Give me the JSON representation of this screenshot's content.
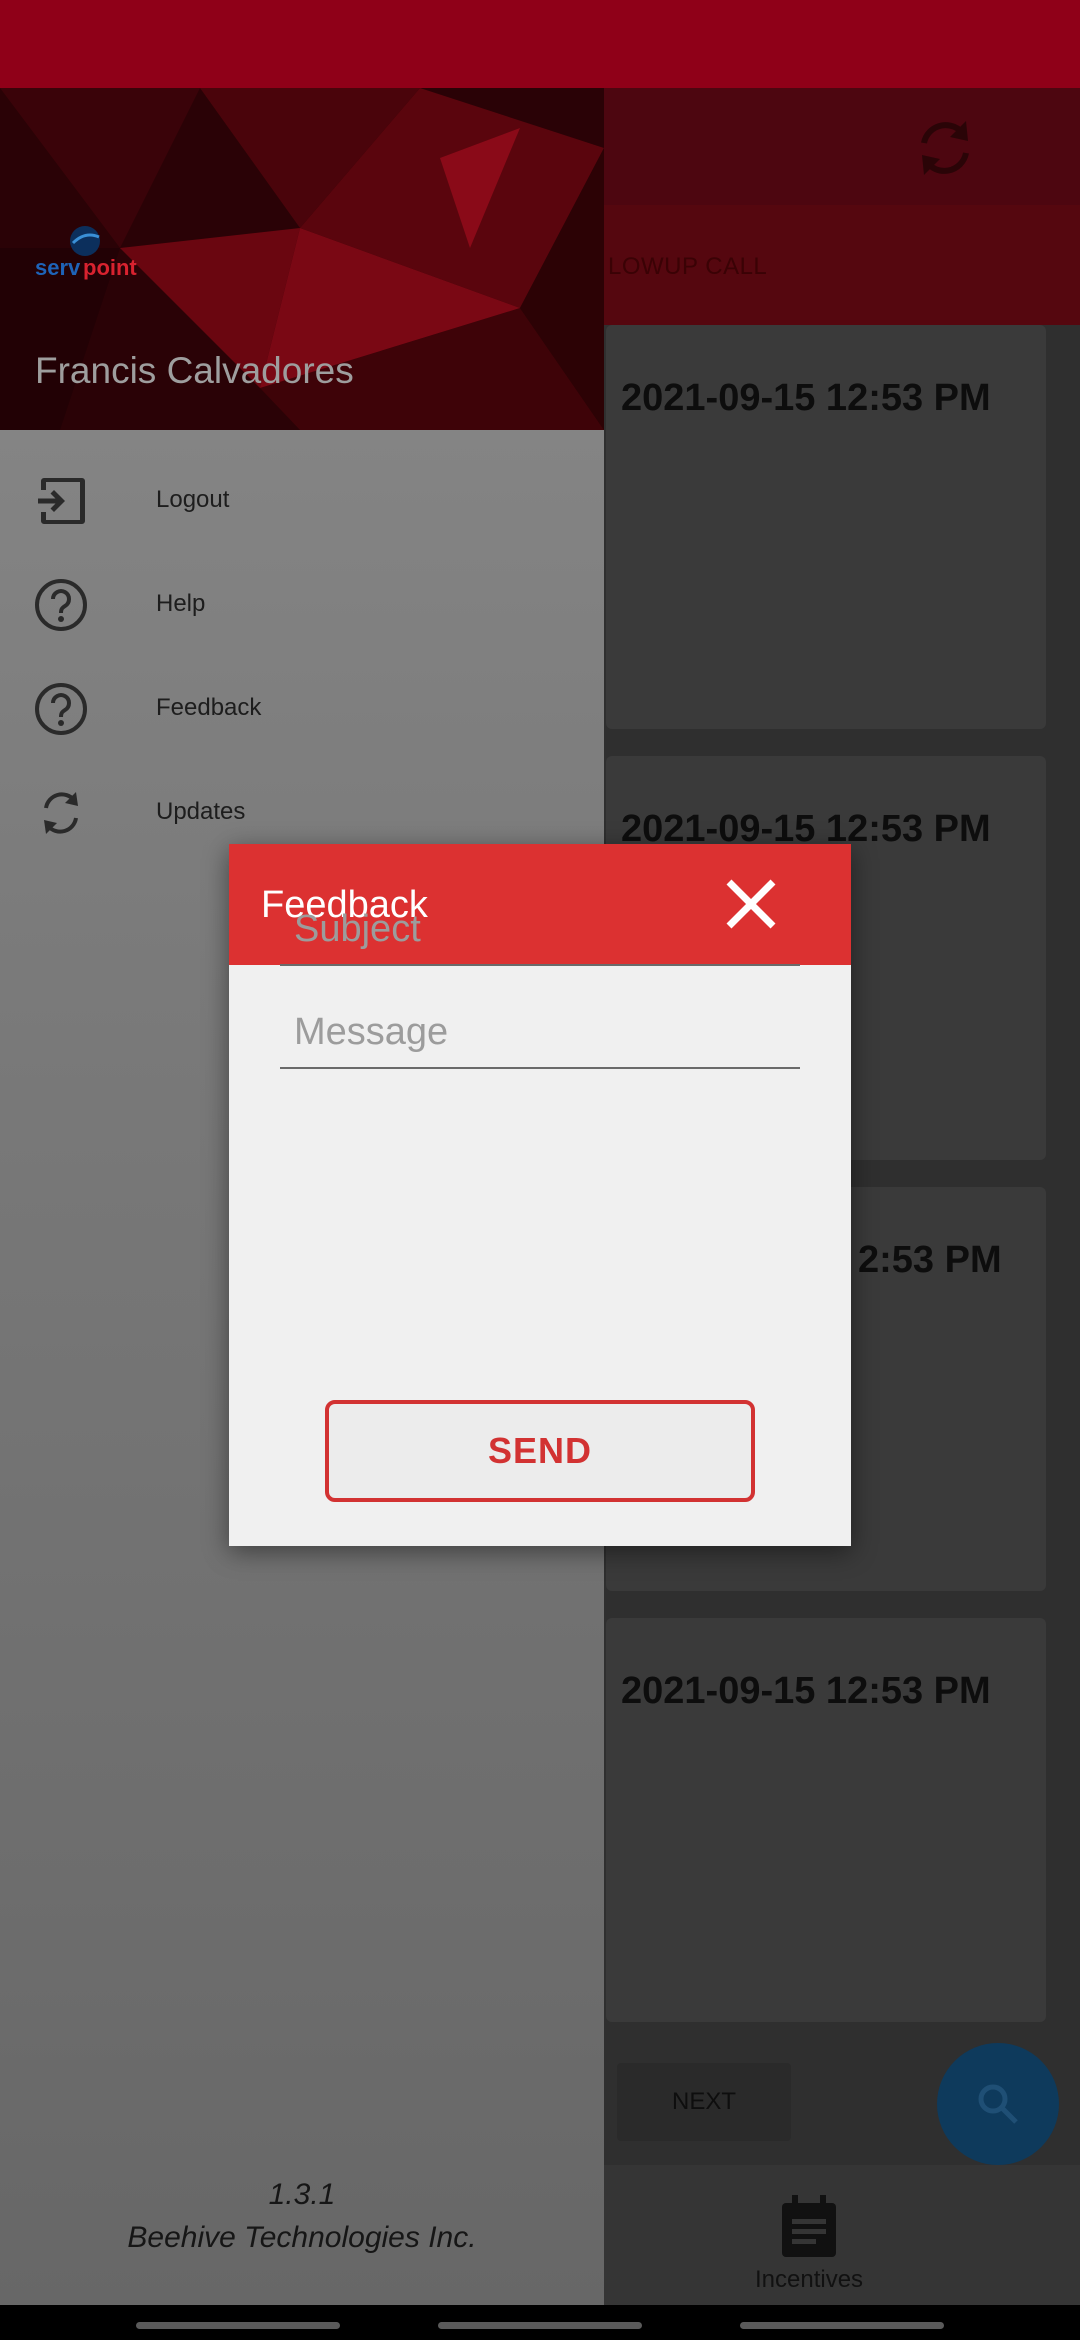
{
  "app": {
    "tab_label": "LOWUP CALL",
    "cards": [
      {
        "date": "2021-09-15 12:53 PM"
      },
      {
        "date": "2021-09-15 12:53 PM"
      },
      {
        "date": "2:53 PM"
      },
      {
        "date": "2021-09-15 12:53 PM"
      }
    ],
    "next_label": "NEXT",
    "bottom_nav_label": "Incentives"
  },
  "drawer": {
    "logo_text_serv": "serv",
    "logo_text_point": "point",
    "user_name": "Francis Calvadores",
    "items": [
      {
        "label": "Logout",
        "icon": "logout-icon"
      },
      {
        "label": "Help",
        "icon": "help-icon"
      },
      {
        "label": "Feedback",
        "icon": "help-icon"
      },
      {
        "label": "Updates",
        "icon": "sync-icon"
      }
    ],
    "version": "1.3.1",
    "company": "Beehive Technologies Inc."
  },
  "dialog": {
    "title": "Feedback",
    "subject_placeholder": "Subject",
    "message_placeholder": "Message",
    "send_label": "SEND"
  },
  "colors": {
    "status_bar": "#8f0018",
    "dialog_header": "#dc3131",
    "send_border": "#d23232"
  }
}
